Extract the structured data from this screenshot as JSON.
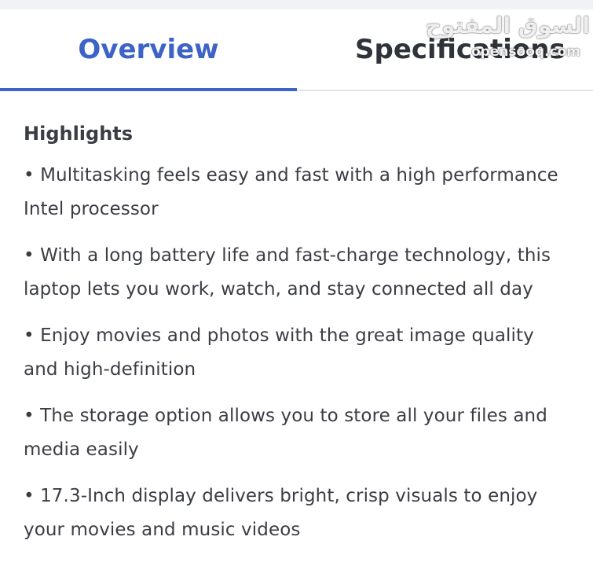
{
  "tabs": [
    {
      "label": "Overview",
      "active": true
    },
    {
      "label": "Specifications",
      "active": false
    }
  ],
  "watermark": {
    "arabic": "السوق المفتوح",
    "latin": "opensooq.com"
  },
  "highlights": {
    "heading": "Highlights",
    "items": [
      "• Multitasking feels easy and fast with a high performance Intel processor",
      "• With a long battery life and fast-charge technology, this laptop lets you work, watch, and stay connected all day",
      "• Enjoy movies and photos with the great image quality and high-definition",
      "• The storage option allows you to store all your files and media easily",
      "• 17.3-Inch display delivers bright, crisp visuals to enjoy your movies and music videos"
    ]
  },
  "colors": {
    "accent": "#3c63c5",
    "text": "#3a3d44",
    "divider": "#e3e5e8"
  }
}
